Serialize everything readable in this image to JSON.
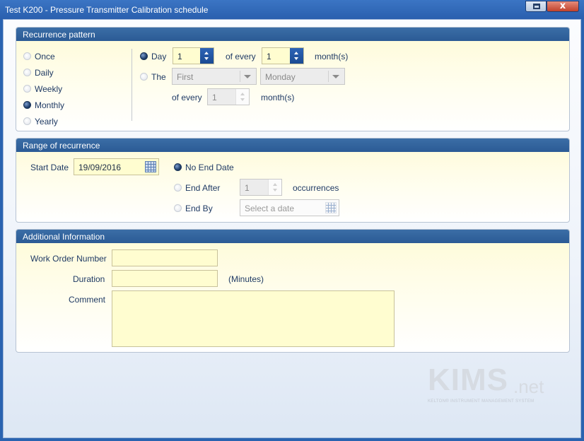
{
  "window": {
    "title": "Test K200 - Pressure Transmitter Calibration schedule",
    "close_glyph": "x",
    "accent": "#2a63b0"
  },
  "recurrence": {
    "header": "Recurrence pattern",
    "options": [
      {
        "label": "Once",
        "selected": false
      },
      {
        "label": "Daily",
        "selected": false
      },
      {
        "label": "Weekly",
        "selected": false
      },
      {
        "label": "Monthly",
        "selected": true
      },
      {
        "label": "Yearly",
        "selected": false
      }
    ],
    "day_label": "Day",
    "day_value": "1",
    "of_every_label": "of every",
    "months_value": "1",
    "months_label": "month(s)",
    "the_label": "The",
    "ordinal_value": "First",
    "weekday_value": "Monday",
    "of_every_label_2": "of every",
    "months_value_2": "1",
    "months_label_2": "month(s)"
  },
  "range": {
    "header": "Range of recurrence",
    "start_label": "Start Date",
    "start_value": "19/09/2016",
    "no_end_label": "No End Date",
    "end_after_label": "End After",
    "occurrences_value": "1",
    "occurrences_label": "occurrences",
    "end_by_label": "End By",
    "end_by_placeholder": "Select a date"
  },
  "additional": {
    "header": "Additional Information",
    "work_order_label": "Work Order Number",
    "work_order_value": "",
    "duration_label": "Duration",
    "duration_value": "",
    "minutes_label": "(Minutes)",
    "comment_label": "Comment",
    "comment_value": ""
  },
  "logo": {
    "brand": "KIMS",
    "suffix": ".net",
    "tagline": "KELTON® INSTRUMENT MANAGEMENT SYSTEM"
  },
  "icons": {
    "maximize": "maximize-icon",
    "close": "close-icon",
    "calendar": "calendar-icon"
  }
}
